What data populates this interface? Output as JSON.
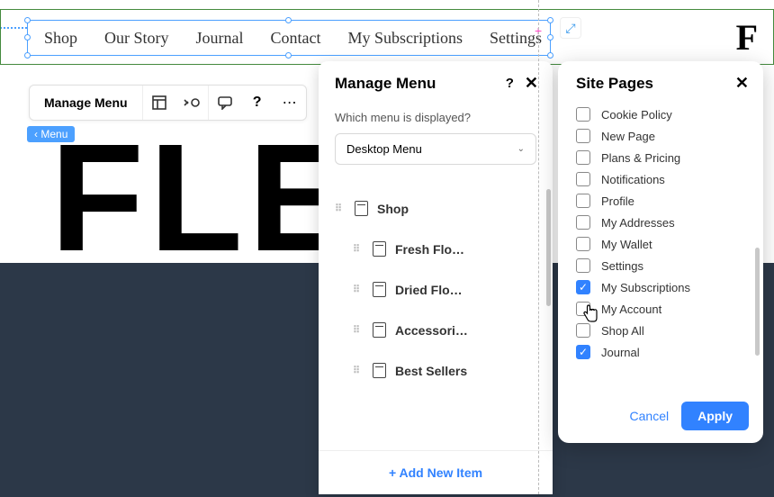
{
  "brand_letter": "F",
  "nav": {
    "items": [
      "Shop",
      "Our Story",
      "Journal",
      "Contact",
      "My Subscriptions",
      "Settings"
    ]
  },
  "context_bar": {
    "label": "Manage Menu"
  },
  "menu_tag": "Menu",
  "background_text": "FLE",
  "manage_menu_panel": {
    "title": "Manage Menu",
    "question": "Which menu is displayed?",
    "dropdown_value": "Desktop Menu",
    "items": [
      {
        "label": "Shop",
        "child": false
      },
      {
        "label": "Fresh Flo…",
        "child": true
      },
      {
        "label": "Dried Flo…",
        "child": true
      },
      {
        "label": "Accessori…",
        "child": true
      },
      {
        "label": "Best Sellers",
        "child": true
      }
    ],
    "add_new_label": "+ Add New Item"
  },
  "site_pages_panel": {
    "title": "Site Pages",
    "items": [
      {
        "label": "Cookie Policy",
        "checked": false
      },
      {
        "label": "New Page",
        "checked": false
      },
      {
        "label": "Plans & Pricing",
        "checked": false
      },
      {
        "label": "Notifications",
        "checked": false
      },
      {
        "label": "Profile",
        "checked": false
      },
      {
        "label": "My Addresses",
        "checked": false
      },
      {
        "label": "My Wallet",
        "checked": false
      },
      {
        "label": "Settings",
        "checked": false
      },
      {
        "label": "My Subscriptions",
        "checked": true
      },
      {
        "label": "My Account",
        "checked": false
      },
      {
        "label": "Shop All",
        "checked": false
      },
      {
        "label": "Journal",
        "checked": true
      }
    ],
    "cancel_label": "Cancel",
    "apply_label": "Apply"
  }
}
